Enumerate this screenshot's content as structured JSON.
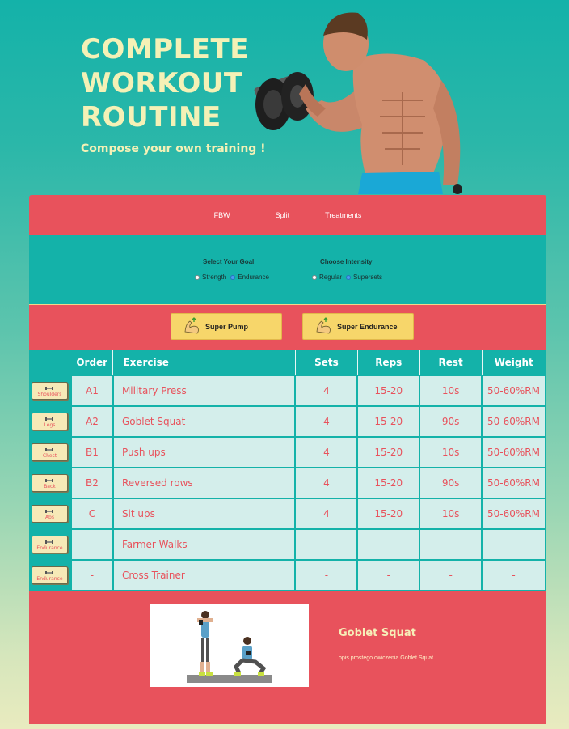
{
  "hero": {
    "title": "COMPLETE WORKOUT ROUTINE",
    "subtitle": "Compose your own training !"
  },
  "nav": {
    "items": [
      "FBW",
      "Split",
      "Treatments"
    ]
  },
  "options": {
    "goal": {
      "title": "Select Your Goal",
      "choices": [
        "Strength",
        "Endurance"
      ],
      "selected": "Endurance"
    },
    "intensity": {
      "title": "Choose Intensity",
      "choices": [
        "Regular",
        "Supersets"
      ],
      "selected": "Supersets"
    }
  },
  "presets": [
    "Super Pump",
    "Super Endurance"
  ],
  "table": {
    "headers": [
      "Order",
      "Exercise",
      "Sets",
      "Reps",
      "Rest",
      "Weight"
    ],
    "rows": [
      {
        "tag": "Shoulders",
        "order": "A1",
        "exercise": "Military Press",
        "sets": "4",
        "reps": "15-20",
        "rest": "10s",
        "weight": "50-60%RM"
      },
      {
        "tag": "Legs",
        "order": "A2",
        "exercise": "Goblet Squat",
        "sets": "4",
        "reps": "15-20",
        "rest": "90s",
        "weight": "50-60%RM"
      },
      {
        "tag": "Chest",
        "order": "B1",
        "exercise": "Push ups",
        "sets": "4",
        "reps": "15-20",
        "rest": "10s",
        "weight": "50-60%RM"
      },
      {
        "tag": "Back",
        "order": "B2",
        "exercise": "Reversed rows",
        "sets": "4",
        "reps": "15-20",
        "rest": "90s",
        "weight": "50-60%RM"
      },
      {
        "tag": "Abs",
        "order": "C",
        "exercise": "Sit ups",
        "sets": "4",
        "reps": "15-20",
        "rest": "10s",
        "weight": "50-60%RM"
      },
      {
        "tag": "Endurance",
        "order": "-",
        "exercise": "Farmer Walks",
        "sets": "-",
        "reps": "-",
        "rest": "-",
        "weight": "-"
      },
      {
        "tag": "Endurance",
        "order": "-",
        "exercise": "Cross Trainer",
        "sets": "-",
        "reps": "-",
        "rest": "-",
        "weight": "-"
      }
    ]
  },
  "detail": {
    "title": "Goblet Squat",
    "description": "opis prostego cwiczenia Goblet Squat"
  },
  "colors": {
    "teal": "#14b2a9",
    "coral": "#e8525c",
    "yellow": "#f7d66a",
    "cream": "#f4f1b6",
    "row_bg": "#d4eeeb"
  }
}
